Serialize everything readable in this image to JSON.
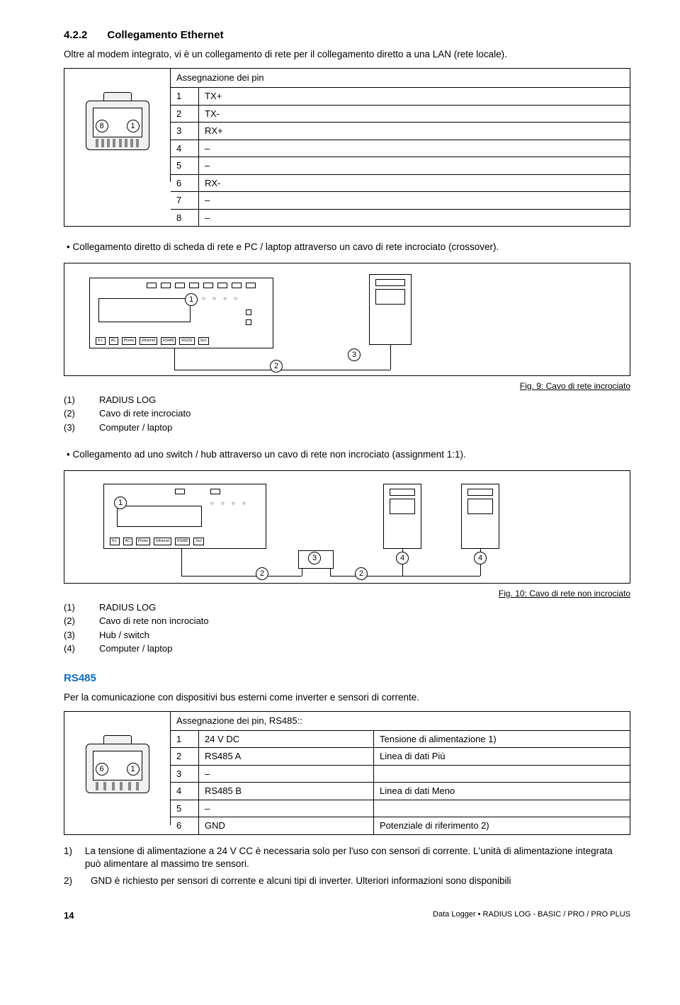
{
  "section": {
    "num": "4.2.2",
    "title": "Collegamento Ethernet"
  },
  "intro": "Oltre al modem integrato, vi è un collegamento di rete per il collegamento diretto a una LAN (rete locale).",
  "pinEth": {
    "header": "Assegnazione dei pin",
    "leftNum": "8",
    "rightNum": "1",
    "rows": [
      {
        "pin": "1",
        "sig": "TX+"
      },
      {
        "pin": "2",
        "sig": "TX-"
      },
      {
        "pin": "3",
        "sig": "RX+"
      },
      {
        "pin": "4",
        "sig": "–"
      },
      {
        "pin": "5",
        "sig": "–"
      },
      {
        "pin": "6",
        "sig": "RX-"
      },
      {
        "pin": "7",
        "sig": "–"
      },
      {
        "pin": "8",
        "sig": "–"
      }
    ]
  },
  "bullet1": "Collegamento diretto di scheda di rete e PC / laptop attraverso un cavo di rete incrociato (crossover).",
  "fig9": {
    "caption": "Fig. 9: Cavo di rete incrociato",
    "n1": "1",
    "n2": "2",
    "n3": "3",
    "legend": [
      {
        "n": "(1)",
        "t": "RADIUS LOG"
      },
      {
        "n": "(2)",
        "t": "Cavo di rete incrociato"
      },
      {
        "n": "(3)",
        "t": "Computer / laptop"
      }
    ]
  },
  "bullet2": "Collegamento ad uno switch / hub attraverso un cavo di rete non incrociato (assignment 1:1).",
  "fig10": {
    "caption": "Fig. 10: Cavo di rete non incrociato",
    "n1": "1",
    "n2": "2",
    "n3": "3",
    "n4": "4",
    "legend": [
      {
        "n": "(1)",
        "t": "RADIUS LOG"
      },
      {
        "n": "(2)",
        "t": "Cavo di rete non incrociato"
      },
      {
        "n": "(3)",
        "t": "Hub / switch"
      },
      {
        "n": "(4)",
        "t": "Computer / laptop"
      }
    ]
  },
  "rs485": {
    "title": "RS485",
    "desc": "Per la comunicazione con dispositivi bus esterni come inverter e sensori di corrente.",
    "header": "Assegnazione dei pin, RS485::",
    "leftNum": "6",
    "rightNum": "1",
    "rows": [
      {
        "pin": "1",
        "sig": "24 V DC",
        "desc": "Tensione di alimentazione 1)"
      },
      {
        "pin": "2",
        "sig": "RS485 A",
        "desc": "Linea di dati Più"
      },
      {
        "pin": "3",
        "sig": "–",
        "desc": ""
      },
      {
        "pin": "4",
        "sig": "RS485 B",
        "desc": "Linea di dati Meno"
      },
      {
        "pin": "5",
        "sig": "–",
        "desc": ""
      },
      {
        "pin": "6",
        "sig": "GND",
        "desc": "Potenziale di riferimento 2)"
      }
    ]
  },
  "notes": [
    {
      "n": "1)",
      "t": "La tensione di alimentazione a 24 V CC è necessaria solo per l'uso con sensori di corrente. L'unità di alimentazione integrata può alimentare al massimo tre sensori."
    },
    {
      "n": "2)",
      "t": "GND è richiesto per sensori di corrente e alcuni tipi di inverter. Ulteriori informazioni sono disponibili"
    }
  ],
  "footer": {
    "page": "14",
    "doc": "Data Logger • RADIUS LOG - BASIC / PRO / PRO PLUS"
  }
}
